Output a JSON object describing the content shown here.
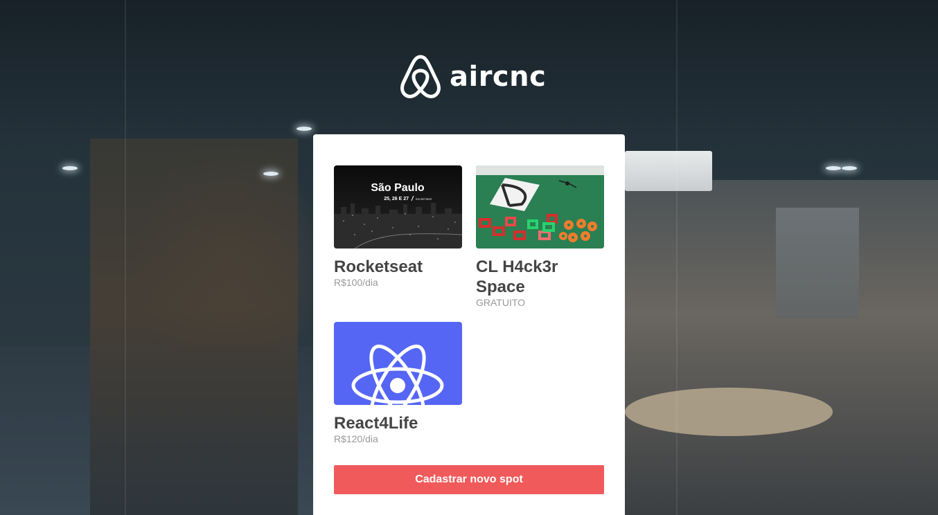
{
  "brand": {
    "name": "aircnc",
    "logo_icon": "airbnb-belo-icon"
  },
  "spots": [
    {
      "company": "Rocketseat",
      "price": "R$100/dia",
      "thumbnail": {
        "kind": "city-night-photo",
        "title": "São Paulo",
        "subtitle": "25, 26 E 27",
        "tag": "ROCKETSEAT"
      }
    },
    {
      "company": "CL H4ck3r Space",
      "price": "GRATUITO",
      "thumbnail": {
        "kind": "3d-printed-parts-photo"
      }
    },
    {
      "company": "React4Life",
      "price": "R$120/dia",
      "thumbnail": {
        "kind": "react-logo",
        "background": "#5566f5"
      }
    }
  ],
  "actions": {
    "new_spot_label": "Cadastrar novo spot"
  },
  "colors": {
    "accent": "#f05a5b",
    "title_text": "#444444",
    "price_text": "#999999"
  }
}
